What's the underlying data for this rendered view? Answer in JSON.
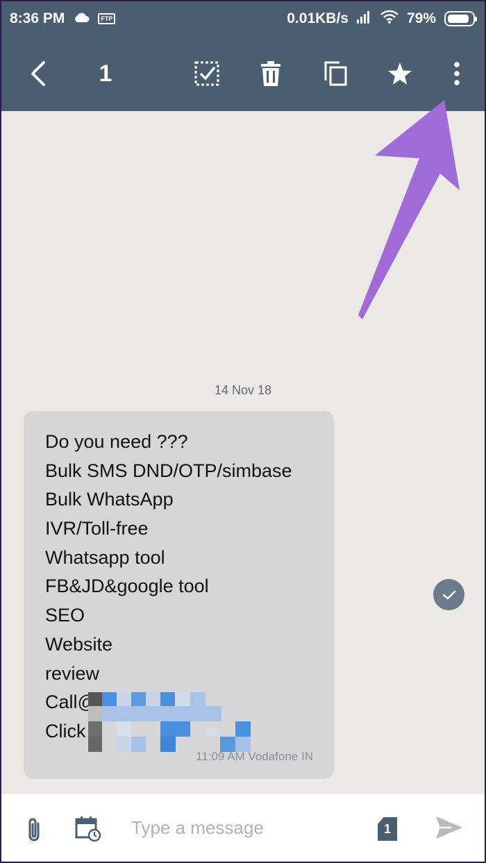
{
  "status_bar": {
    "time": "8:36 PM",
    "ftp_label": "FTP",
    "network_speed": "0.01KB/s",
    "battery": "79%",
    "icons": [
      "cloud-icon",
      "ftp-icon",
      "signal-icon",
      "wifi-icon",
      "battery-icon"
    ]
  },
  "toolbar": {
    "selected_count": "1",
    "icons": [
      "back-icon",
      "select-all-icon",
      "delete-icon",
      "copy-icon",
      "star-icon",
      "more-options-icon"
    ]
  },
  "conversation": {
    "date_label": "14 Nov 18",
    "message": {
      "lines": [
        "Do you need ???",
        "Bulk SMS DND/OTP/simbase",
        "Bulk WhatsApp",
        "IVR/Toll-free",
        "Whatsapp tool",
        "FB&JD&google tool",
        "SEO",
        "Website",
        "review",
        "Call@",
        "Click"
      ],
      "meta": "11:09 AM  Vodafone IN",
      "selected": true
    }
  },
  "compose": {
    "placeholder": "Type a message",
    "sim_slot": "1",
    "icons": [
      "attach-icon",
      "schedule-icon",
      "sim-icon",
      "send-icon"
    ]
  },
  "colors": {
    "toolbar": "#4b5e70",
    "background": "#ebe8e6",
    "bubble": "#d6d6d9",
    "annotation_arrow": "#a06bd6"
  }
}
